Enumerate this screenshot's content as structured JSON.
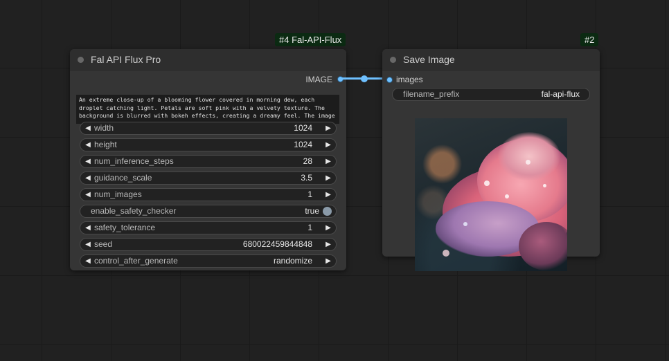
{
  "left_node": {
    "badge": "#4 Fal-API-Flux",
    "title": "Fal API Flux Pro",
    "output_label": "IMAGE",
    "prompt": "An extreme close-up of a blooming flower covered in morning dew, each droplet catching light. Petals are soft pink with a velvety texture. The background is blurred with bokeh effects, creating a dreamy feel. The image",
    "widgets": [
      {
        "label": "width",
        "value": "1024"
      },
      {
        "label": "height",
        "value": "1024"
      },
      {
        "label": "num_inference_steps",
        "value": "28"
      },
      {
        "label": "guidance_scale",
        "value": "3.5"
      },
      {
        "label": "num_images",
        "value": "1"
      },
      {
        "label": "enable_safety_checker",
        "value": "true"
      },
      {
        "label": "safety_tolerance",
        "value": "1"
      },
      {
        "label": "seed",
        "value": "680022459844848"
      },
      {
        "label": "control_after_generate",
        "value": "randomize"
      }
    ]
  },
  "right_node": {
    "badge": "#2",
    "title": "Save Image",
    "input_label": "images",
    "filename_prefix": {
      "label": "filename_prefix",
      "value": "fal-api-flux"
    }
  },
  "colors": {
    "link": "#6ec0ff",
    "badge_bg": "#0b2a12",
    "canvas": "#212121"
  }
}
